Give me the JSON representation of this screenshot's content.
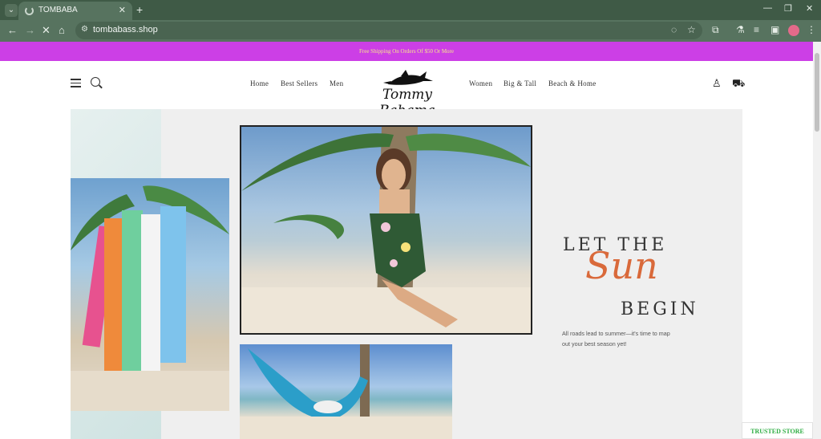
{
  "browser": {
    "tab_title": "TOMBABA",
    "url": "tombabass.shop",
    "new_tab_symbol": "+",
    "close_tab_symbol": "✕",
    "window_controls": [
      "—",
      "❐",
      "✕"
    ]
  },
  "announcement": {
    "text": "Free Shipping On Orders Of $50 Or More",
    "background": "#cc3fe6",
    "text_color": "#f6e98a"
  },
  "header": {
    "logo_text": "Tommy Bahama",
    "nav_left": [
      "Home",
      "Best Sellers",
      "Men"
    ],
    "nav_right": [
      "Women",
      "Big & Tall",
      "Beach & Home"
    ],
    "icons": [
      "menu-icon",
      "search-icon",
      "account-icon",
      "cart-icon"
    ]
  },
  "hero": {
    "headline_top": "LET THE",
    "headline_script": "Sun",
    "headline_bottom": "BEGIN",
    "copy": "All roads lead to summer—it's time to map out your best season yet!",
    "accent_color": "#d9693a"
  },
  "trust_badge": {
    "label": "TRUSTED STORE",
    "color": "#2fae44"
  }
}
